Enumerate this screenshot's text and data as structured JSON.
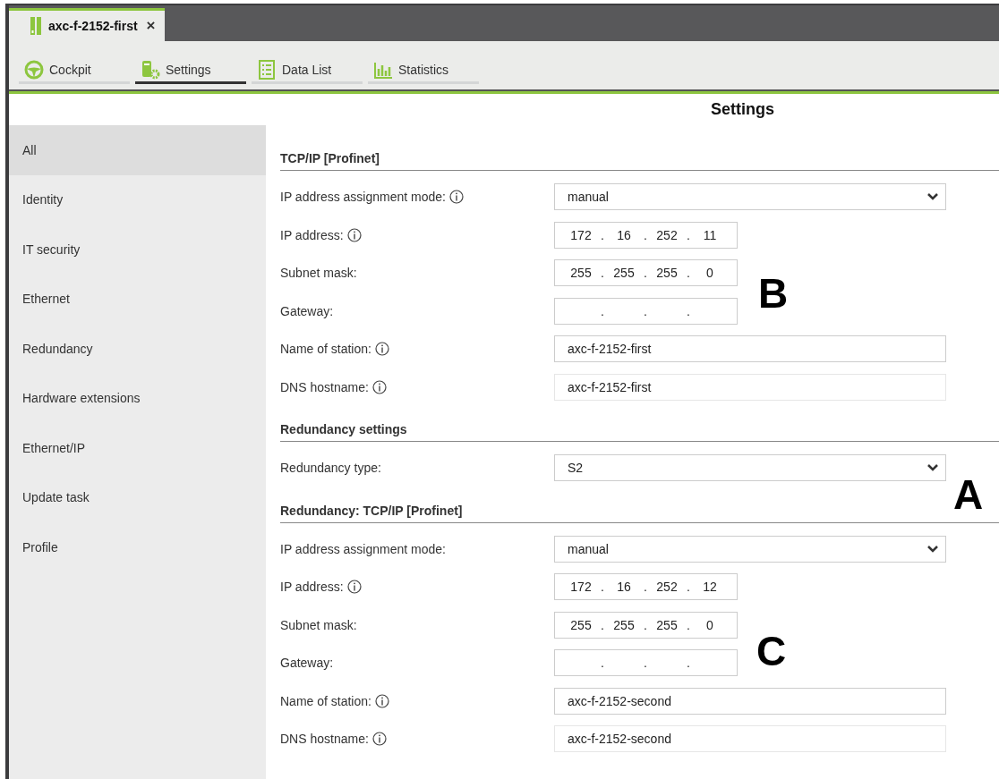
{
  "document_tabs": [
    {
      "label": "axc-f-2152-first",
      "close": "×",
      "selected": true
    }
  ],
  "nav_tabs": [
    {
      "label": "Cockpit",
      "selected": false
    },
    {
      "label": "Settings",
      "selected": true
    },
    {
      "label": "Data List",
      "selected": false
    },
    {
      "label": "Statistics",
      "selected": false
    }
  ],
  "sidebar": {
    "items": [
      {
        "label": "All",
        "selected": true
      },
      {
        "label": "Identity",
        "selected": false
      },
      {
        "label": "IT security",
        "selected": false
      },
      {
        "label": "Ethernet",
        "selected": false
      },
      {
        "label": "Redundancy",
        "selected": false
      },
      {
        "label": "Hardware extensions",
        "selected": false
      },
      {
        "label": "Ethernet/IP",
        "selected": false
      },
      {
        "label": "Update task",
        "selected": false
      },
      {
        "label": "Profile",
        "selected": false
      }
    ]
  },
  "page_title": "Settings",
  "sections": [
    {
      "heading": "TCP/IP [Profinet]",
      "rows": [
        {
          "label": "IP address assignment mode:",
          "info": true,
          "kind": "select",
          "value": "manual"
        },
        {
          "label": "IP address:",
          "info": true,
          "kind": "ip",
          "separator": ".",
          "octets": [
            "172",
            "16",
            "252",
            "11"
          ]
        },
        {
          "label": "Subnet mask:",
          "info": false,
          "kind": "ip",
          "separator": ".",
          "octets": [
            "255",
            "255",
            "255",
            "0"
          ]
        },
        {
          "label": "Gateway:",
          "info": false,
          "kind": "ip",
          "separator": "."
        },
        {
          "label": "Name of station:",
          "info": true,
          "kind": "text",
          "value": "axc-f-2152-first",
          "readonly": false
        },
        {
          "label": "DNS hostname:",
          "info": true,
          "kind": "text",
          "value": "axc-f-2152-first",
          "readonly": true
        }
      ]
    },
    {
      "heading": "Redundancy settings",
      "rows": [
        {
          "label": "Redundancy type:",
          "info": false,
          "kind": "select",
          "value": "S2"
        }
      ]
    },
    {
      "heading": "Redundancy: TCP/IP [Profinet]",
      "rows": [
        {
          "label": "IP address assignment mode:",
          "info": false,
          "kind": "select",
          "value": "manual"
        },
        {
          "label": "IP address:",
          "info": true,
          "kind": "ip",
          "separator": ".",
          "octets": [
            "172",
            "16",
            "252",
            "12"
          ]
        },
        {
          "label": "Subnet mask:",
          "info": false,
          "kind": "ip",
          "separator": ".",
          "octets": [
            "255",
            "255",
            "255",
            "0"
          ]
        },
        {
          "label": "Gateway:",
          "info": false,
          "kind": "ip",
          "separator": "."
        },
        {
          "label": "Name of station:",
          "info": true,
          "kind": "text",
          "value": "axc-f-2152-second",
          "readonly": false
        },
        {
          "label": "DNS hostname:",
          "info": true,
          "kind": "text",
          "value": "axc-f-2152-second",
          "readonly": true
        }
      ]
    }
  ],
  "callouts": [
    "B",
    "A",
    "C"
  ]
}
